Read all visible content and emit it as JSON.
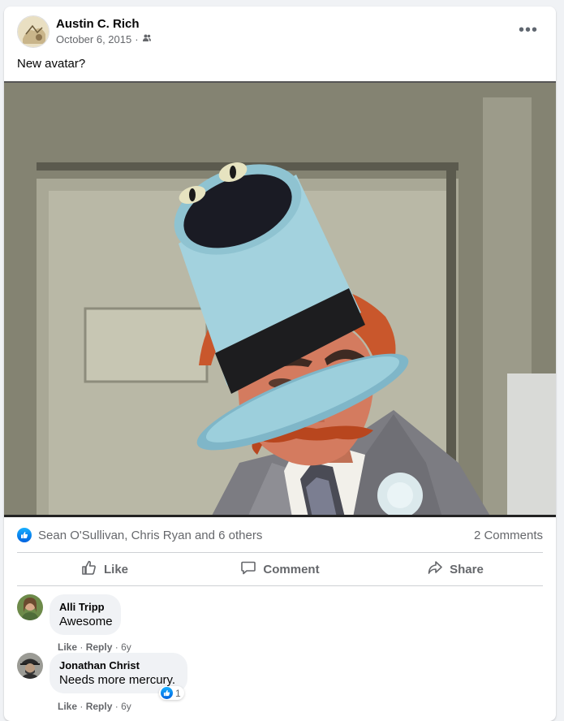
{
  "post": {
    "author": "Austin C. Rich",
    "date": "October 6, 2015",
    "audience_separator": "·",
    "audience_icon": "friends-icon",
    "more_icon": "•••",
    "text": "New avatar?"
  },
  "reactions": {
    "reactors": "Sean O'Sullivan, Chris Ryan and 6 others",
    "comments_count": "2 Comments"
  },
  "actions": {
    "like": "Like",
    "comment": "Comment",
    "share": "Share"
  },
  "comments": [
    {
      "name": "Alli Tripp",
      "text": "Awesome",
      "like": "Like",
      "reply": "Reply",
      "sep": "·",
      "age": "6y"
    },
    {
      "name": "Jonathan Christ",
      "text": "Needs more mercury.",
      "like": "Like",
      "reply": "Reply",
      "sep": "·",
      "age": "6y",
      "reaction_count": "1"
    }
  ],
  "colors": {
    "brand_blue": "#1877f2",
    "text_secondary": "#65676b"
  }
}
